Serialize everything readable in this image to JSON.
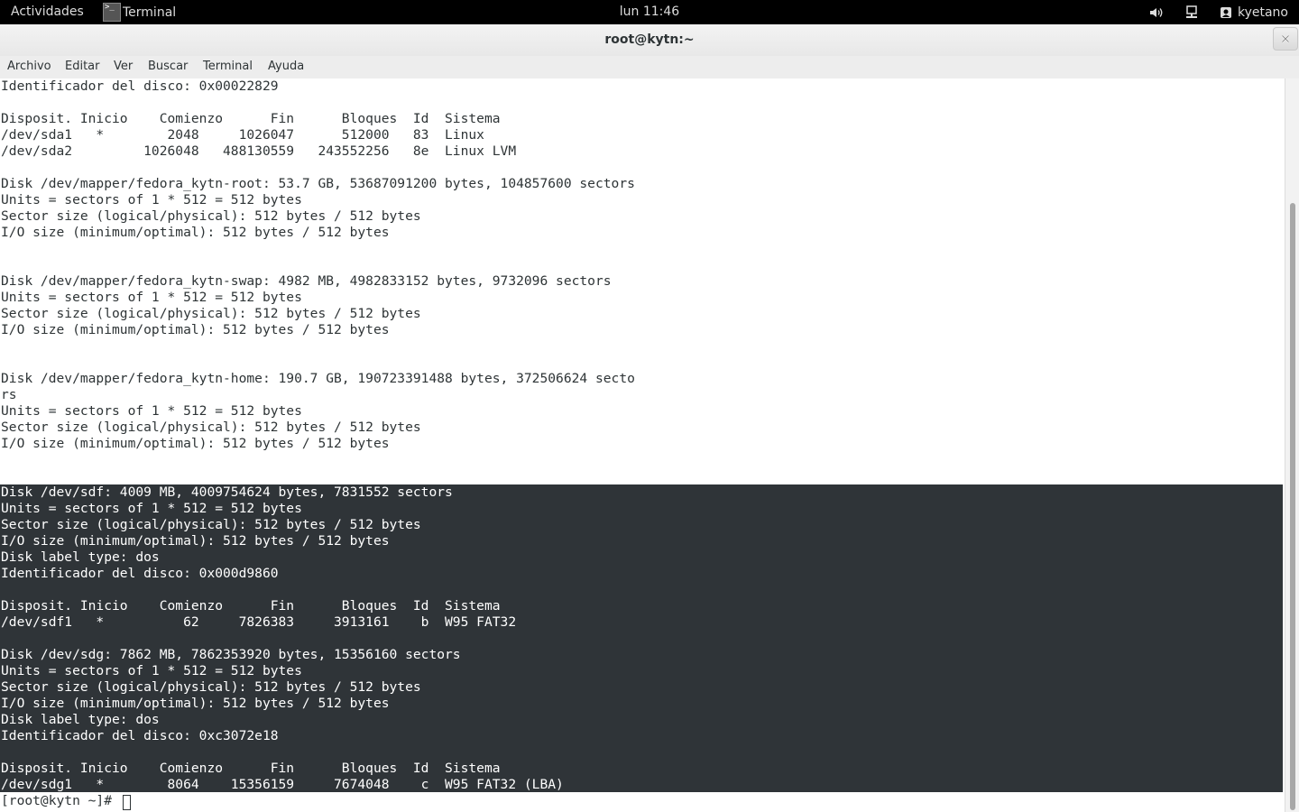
{
  "topbar": {
    "activities": "Actividades",
    "app_name": "Terminal",
    "clock": "lun 11:46",
    "user": "kyetano",
    "icons": [
      "volume-icon",
      "network-icon",
      "user-icon"
    ]
  },
  "window": {
    "title": "root@kytn:~"
  },
  "menubar": {
    "items": [
      "Archivo",
      "Editar",
      "Ver",
      "Buscar",
      "Terminal",
      "Ayuda"
    ]
  },
  "terminal": {
    "lines": [
      "Identificador del disco: 0x00022829",
      "",
      "Disposit. Inicio    Comienzo      Fin      Bloques  Id  Sistema",
      "/dev/sda1   *        2048     1026047      512000   83  Linux",
      "/dev/sda2         1026048   488130559   243552256   8e  Linux LVM",
      "",
      "Disk /dev/mapper/fedora_kytn-root: 53.7 GB, 53687091200 bytes, 104857600 sectors",
      "Units = sectors of 1 * 512 = 512 bytes",
      "Sector size (logical/physical): 512 bytes / 512 bytes",
      "I/O size (minimum/optimal): 512 bytes / 512 bytes",
      "",
      "",
      "Disk /dev/mapper/fedora_kytn-swap: 4982 MB, 4982833152 bytes, 9732096 sectors",
      "Units = sectors of 1 * 512 = 512 bytes",
      "Sector size (logical/physical): 512 bytes / 512 bytes",
      "I/O size (minimum/optimal): 512 bytes / 512 bytes",
      "",
      "",
      "Disk /dev/mapper/fedora_kytn-home: 190.7 GB, 190723391488 bytes, 372506624 secto",
      "rs",
      "Units = sectors of 1 * 512 = 512 bytes",
      "Sector size (logical/physical): 512 bytes / 512 bytes",
      "I/O size (minimum/optimal): 512 bytes / 512 bytes",
      "",
      "",
      "Disk /dev/sdf: 4009 MB, 4009754624 bytes, 7831552 sectors",
      "Units = sectors of 1 * 512 = 512 bytes",
      "Sector size (logical/physical): 512 bytes / 512 bytes",
      "I/O size (minimum/optimal): 512 bytes / 512 bytes",
      "Disk label type: dos",
      "Identificador del disco: 0x000d9860",
      "",
      "Disposit. Inicio    Comienzo      Fin      Bloques  Id  Sistema",
      "/dev/sdf1   *          62     7826383     3913161    b  W95 FAT32",
      "",
      "Disk /dev/sdg: 7862 MB, 7862353920 bytes, 15356160 sectors",
      "Units = sectors of 1 * 512 = 512 bytes",
      "Sector size (logical/physical): 512 bytes / 512 bytes",
      "I/O size (minimum/optimal): 512 bytes / 512 bytes",
      "Disk label type: dos",
      "Identificador del disco: 0xc3072e18",
      "",
      "Disposit. Inicio    Comienzo      Fin      Bloques  Id  Sistema",
      "/dev/sdg1   *        8064    15356159     7674048    c  W95 FAT32 (LBA)",
      "[root@kytn ~]# "
    ],
    "selection_range": [
      25,
      43
    ]
  },
  "colors": {
    "topbar_bg": "#000000",
    "terminal_bg": "#ffffff",
    "terminal_fg": "#2e3436",
    "selection_bg": "#2f3438",
    "selection_fg": "#ffffff"
  }
}
